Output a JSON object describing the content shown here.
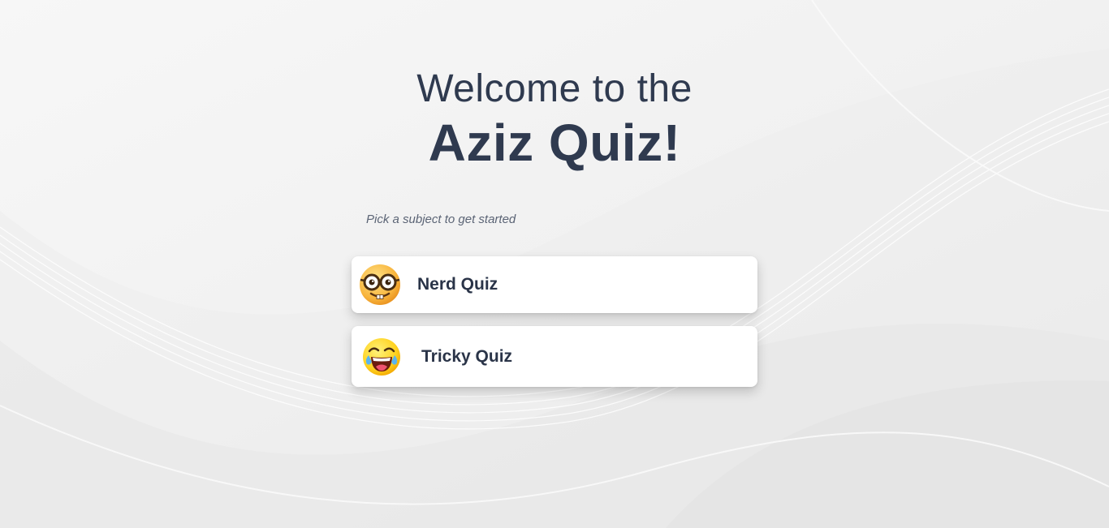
{
  "header": {
    "welcome_text": "Welcome to the",
    "title": "Aziz Quiz!"
  },
  "subtitle": "Pick a subject to get started",
  "quizzes": [
    {
      "label": "Nerd Quiz",
      "icon": "nerd-face-icon"
    },
    {
      "label": "Tricky Quiz",
      "icon": "laughing-crying-face-icon"
    }
  ],
  "colors": {
    "text_primary": "#2f3a4f",
    "background": "#f4f4f4",
    "card": "#ffffff"
  }
}
